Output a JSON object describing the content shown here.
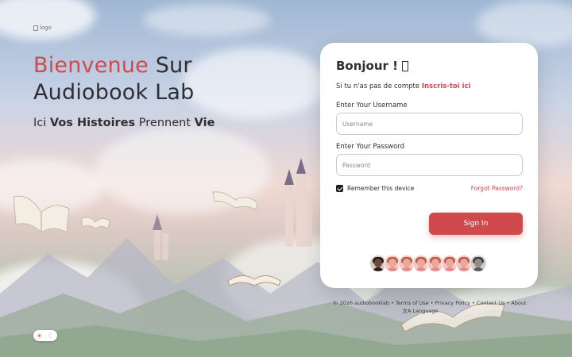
{
  "logo": {
    "alt": "logo"
  },
  "hero": {
    "title_accent": "Bienvenue",
    "title_rest_1": " Sur",
    "title_line2": "Audiobook Lab",
    "tagline_1": "Ici ",
    "tagline_bold_1": "Vos Histoires",
    "tagline_2": " Prennent ",
    "tagline_bold_2": "Vie"
  },
  "card": {
    "greeting": "Bonjour !",
    "signup_text": "Si tu n'as pas de compte ",
    "signup_link": "Inscris-toi ici",
    "username_label": "Enter Your Username",
    "username_placeholder": "Username",
    "username_value": "",
    "password_label": "Enter Your Password",
    "password_placeholder": "Password",
    "password_value": "",
    "remember_label": "Remember this device",
    "remember_checked": true,
    "forgot_label": "Forgot Password?",
    "signin_label": "Sign In"
  },
  "footer": {
    "copyright": "© 2026 audiobooklab",
    "links": [
      "Terms of Use",
      "Privacy Policy",
      "Contact Us",
      "About"
    ],
    "language": "Language",
    "language_icon": "translate-icon"
  },
  "theme_toggle": {
    "light_icon": "sun-icon",
    "dark_icon": "moon-icon"
  },
  "colors": {
    "accent": "#d0494d",
    "text": "#2f2f33",
    "card_bg": "#ffffff"
  }
}
